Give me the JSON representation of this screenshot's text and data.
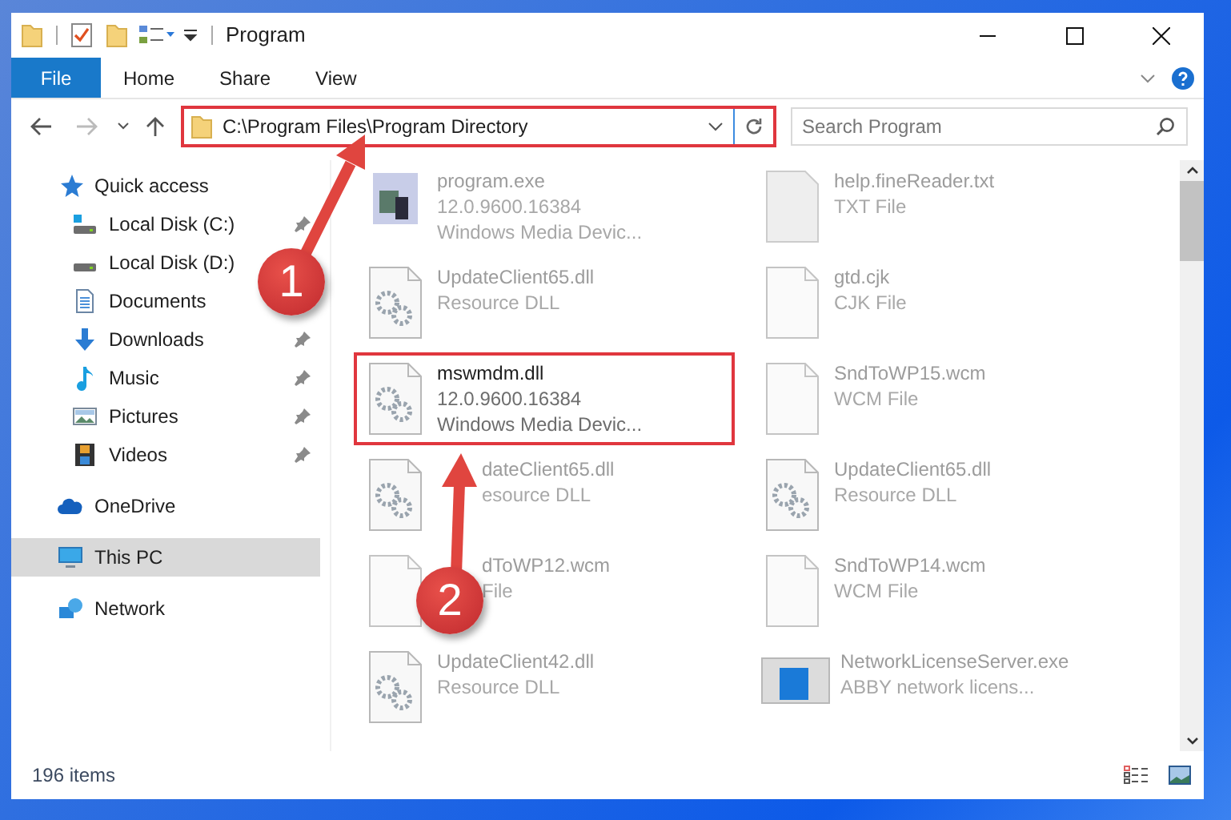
{
  "window": {
    "title": "Program"
  },
  "ribbon": {
    "tabs": [
      {
        "label": "File",
        "kind": "file",
        "selected": false
      },
      {
        "label": "Home",
        "kind": "tab",
        "selected": false
      },
      {
        "label": "Share",
        "kind": "tab",
        "selected": false
      },
      {
        "label": "View",
        "kind": "tab",
        "selected": false
      }
    ]
  },
  "address_bar": {
    "path": "C:\\Program Files\\Program Directory",
    "highlighted": true
  },
  "search": {
    "placeholder": "Search Program"
  },
  "navigation": [
    {
      "label": "Quick access",
      "kind": "star",
      "selected": false,
      "children": [
        {
          "label": "Local Disk (C:)",
          "kind": "disk-c",
          "pinned": true,
          "selected": false
        },
        {
          "label": "Local Disk (D:)",
          "kind": "disk",
          "selected": false
        },
        {
          "label": "Documents",
          "kind": "doc",
          "selected": false
        },
        {
          "label": "Downloads",
          "kind": "download",
          "pinned": true,
          "selected": false
        },
        {
          "label": "Music",
          "kind": "music",
          "pinned": true,
          "selected": false
        },
        {
          "label": "Pictures",
          "kind": "pictures",
          "pinned": true,
          "selected": false
        },
        {
          "label": "Videos",
          "kind": "videos",
          "pinned": true,
          "selected": false
        }
      ]
    },
    {
      "label": "OneDrive",
      "kind": "cloud",
      "selected": false
    },
    {
      "label": "This PC",
      "kind": "pc",
      "selected": true
    },
    {
      "label": "Network",
      "kind": "network",
      "selected": false
    }
  ],
  "files": [
    {
      "name": "program.exe",
      "details": [
        "12.0.9600.16384",
        "Windows Media Devic..."
      ],
      "kind": "exe",
      "blurred": true,
      "highlighted": false
    },
    {
      "name": "help.fineReader.txt",
      "details": [
        "TXT File"
      ],
      "kind": "txt",
      "blurred": true,
      "highlighted": false
    },
    {
      "name": "UpdateClient65.dll",
      "details": [
        "Resource DLL"
      ],
      "kind": "dll",
      "blurred": true,
      "highlighted": false
    },
    {
      "name": "gtd.cjk",
      "details": [
        "CJK File"
      ],
      "kind": "file",
      "blurred": true,
      "highlighted": false
    },
    {
      "name": "mswmdm.dll",
      "details": [
        "12.0.9600.16384",
        "Windows Media Devic..."
      ],
      "kind": "dll",
      "blurred": false,
      "highlighted": true
    },
    {
      "name": "SndToWP15.wcm",
      "details": [
        "WCM File"
      ],
      "kind": "file",
      "blurred": true,
      "highlighted": false
    },
    {
      "name": "dateClient65.dll",
      "details": [
        "esource DLL"
      ],
      "kind": "dll",
      "blurred": true,
      "highlighted": false,
      "obscured": true
    },
    {
      "name": "UpdateClient65.dll",
      "details": [
        "Resource DLL"
      ],
      "kind": "dll",
      "blurred": true,
      "highlighted": false
    },
    {
      "name": "dToWP12.wcm",
      "details": [
        "File"
      ],
      "kind": "file",
      "blurred": true,
      "highlighted": false,
      "obscured": true
    },
    {
      "name": "SndToWP14.wcm",
      "details": [
        "WCM File"
      ],
      "kind": "file",
      "blurred": true,
      "highlighted": false
    },
    {
      "name": "UpdateClient42.dll",
      "details": [
        "Resource DLL"
      ],
      "kind": "dll",
      "blurred": true,
      "highlighted": false
    },
    {
      "name": "NetworkLicenseServer.exe",
      "details": [
        "ABBY network licens..."
      ],
      "kind": "app",
      "blurred": true,
      "highlighted": false
    }
  ],
  "status_bar": {
    "count": "196 items"
  },
  "annotations": [
    {
      "number": "1"
    },
    {
      "number": "2"
    }
  ]
}
